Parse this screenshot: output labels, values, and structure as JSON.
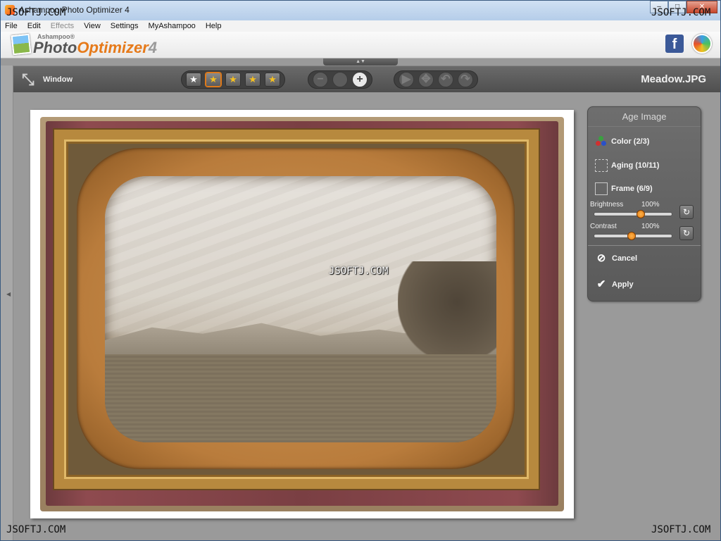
{
  "window": {
    "title": "Ashampoo Photo Optimizer 4",
    "controls": {
      "minimize": "–",
      "maximize": "□",
      "close": "✕"
    }
  },
  "watermarks": {
    "top_left": "JSOFTJ.COM",
    "top_right": "JSOFTJ.COM",
    "bottom_left": "JSOFTJ.COM",
    "bottom_right": "JSOFTJ.COM",
    "center": "JSOFTJ.COM"
  },
  "menu": [
    "File",
    "Edit",
    "Effects",
    "View",
    "Settings",
    "MyAshampoo",
    "Help"
  ],
  "menu_disabled": "Effects",
  "brand": {
    "small": "Ashampoo®",
    "photo": "Photo",
    "optimizer": "Optimizer",
    "version": "4"
  },
  "header_icons": {
    "facebook": "f"
  },
  "toolbar": {
    "window_label": "Window",
    "rating_glyph": "★",
    "zoom": {
      "minus": "−",
      "fit": "",
      "plus": "+"
    },
    "nav": {
      "prev": "▶",
      "move": "✥",
      "undo": "↶",
      "redo": "↷"
    },
    "filename": "Meadow.JPG"
  },
  "panel": {
    "title": "Age Image",
    "options": {
      "color": "Color (2/3)",
      "aging": "Aging (10/11)",
      "frame": "Frame (6/9)"
    },
    "brightness": {
      "label": "Brightness",
      "value_text": "100%",
      "level": 0.6
    },
    "contrast": {
      "label": "Contrast",
      "value_text": "100%",
      "level": 0.48
    },
    "reset_glyph": "↻",
    "cancel": "Cancel",
    "apply": "Apply"
  },
  "colors": {
    "accent": "#e67a1a",
    "toolbar": "#5a5a5a",
    "panel": "#626262"
  }
}
